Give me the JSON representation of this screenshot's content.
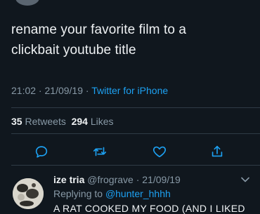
{
  "tweet": {
    "text_line1": "rename your favorite film to a",
    "text_line2": "clickbait youtube title",
    "time": "21:02",
    "date": "21/09/19",
    "separator": " · ",
    "source": "Twitter for iPhone"
  },
  "stats": {
    "retweets_count": "35",
    "retweets_label": "Retweets",
    "likes_count": "294",
    "likes_label": "Likes"
  },
  "actions": {
    "icons": [
      "comment-icon",
      "retweet-icon",
      "heart-icon",
      "share-icon"
    ]
  },
  "reply": {
    "display_name": "ize tria",
    "handle": "@frograve",
    "separator": " · ",
    "date": "21/09/19",
    "replying_to_label": "Replying to ",
    "replying_to_handle": "@hunter_hhhh",
    "text": "A RAT COOKED MY FOOD (AND I LIKED"
  },
  "colors": {
    "background": "#10171e",
    "link": "#1da1f2",
    "secondary_text": "#8899a6",
    "primary_text": "#eef1f3",
    "divider": "#2f3b46"
  }
}
